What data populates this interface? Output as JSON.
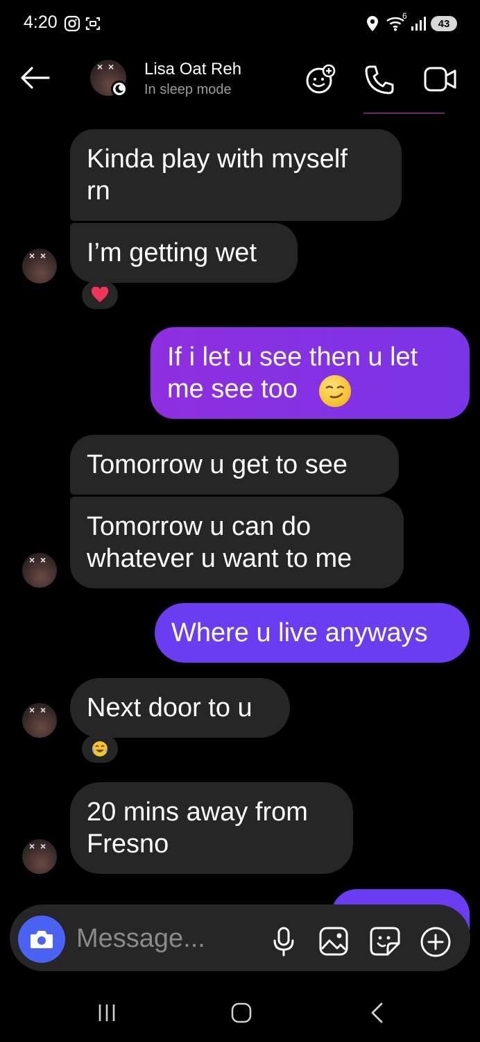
{
  "status_bar": {
    "time": "4:20",
    "network": "6",
    "battery": "43"
  },
  "header": {
    "contact_name": "Lisa Oat Reh",
    "contact_status": "In sleep mode"
  },
  "messages": [
    {
      "direction": "incoming",
      "text": "Kinda play with myself\nrn"
    },
    {
      "direction": "incoming",
      "text": "I’m getting wet",
      "reaction": "heart"
    },
    {
      "direction": "outgoing",
      "text": "If i let u see then u let\nme see too",
      "emoji": "smirk"
    },
    {
      "direction": "incoming",
      "text": "Tomorrow u get to see"
    },
    {
      "direction": "incoming",
      "text": "Tomorrow u can do\nwhatever u want to me"
    },
    {
      "direction": "outgoing",
      "text": "Where u live anyways"
    },
    {
      "direction": "incoming",
      "text": "Next door to u",
      "reaction": "tears-of-joy"
    },
    {
      "direction": "incoming",
      "text": "20 mins away from\nFresno"
    }
  ],
  "composer": {
    "placeholder": "Message..."
  },
  "colors": {
    "incoming_bubble": "#262626",
    "outgoing_gradient_start": "#8e2fe0",
    "outgoing_blue": "#6a3df2",
    "camera_button": "#4a63f2"
  }
}
